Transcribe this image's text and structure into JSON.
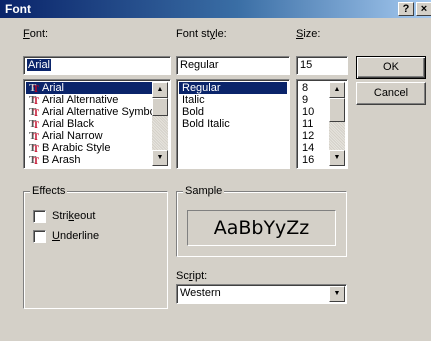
{
  "window": {
    "title": "Font",
    "help_button": "?",
    "close_button": "×"
  },
  "font": {
    "label_pre": "",
    "label_ul": "F",
    "label_post": "ont:",
    "value": "Arial",
    "items": [
      {
        "label": "Arial",
        "selected": true
      },
      {
        "label": "Arial Alternative",
        "selected": false
      },
      {
        "label": "Arial Alternative Symbc",
        "selected": false
      },
      {
        "label": "Arial Black",
        "selected": false
      },
      {
        "label": "Arial Narrow",
        "selected": false
      },
      {
        "label": "B Arabic Style",
        "selected": false
      },
      {
        "label": "B Arash",
        "selected": false
      }
    ]
  },
  "style": {
    "label_pre": "Font st",
    "label_ul": "y",
    "label_post": "le:",
    "value": "Regular",
    "items": [
      {
        "label": "Regular",
        "selected": true
      },
      {
        "label": "Italic",
        "selected": false
      },
      {
        "label": "Bold",
        "selected": false
      },
      {
        "label": "Bold Italic",
        "selected": false
      }
    ]
  },
  "size": {
    "label_pre": "",
    "label_ul": "S",
    "label_post": "ize:",
    "value": "15",
    "items": [
      "8",
      "9",
      "10",
      "11",
      "12",
      "14",
      "16"
    ]
  },
  "buttons": {
    "ok": "OK",
    "cancel": "Cancel"
  },
  "effects": {
    "title": "Effects",
    "strikeout": {
      "pre": "Stri",
      "ul": "k",
      "post": "eout"
    },
    "underline": {
      "pre": "",
      "ul": "U",
      "post": "nderline"
    }
  },
  "sample": {
    "title": "Sample",
    "text": "AaBbYyZz"
  },
  "script": {
    "label_pre": "Sc",
    "label_ul": "r",
    "label_post": "ipt:",
    "value": "Western"
  }
}
